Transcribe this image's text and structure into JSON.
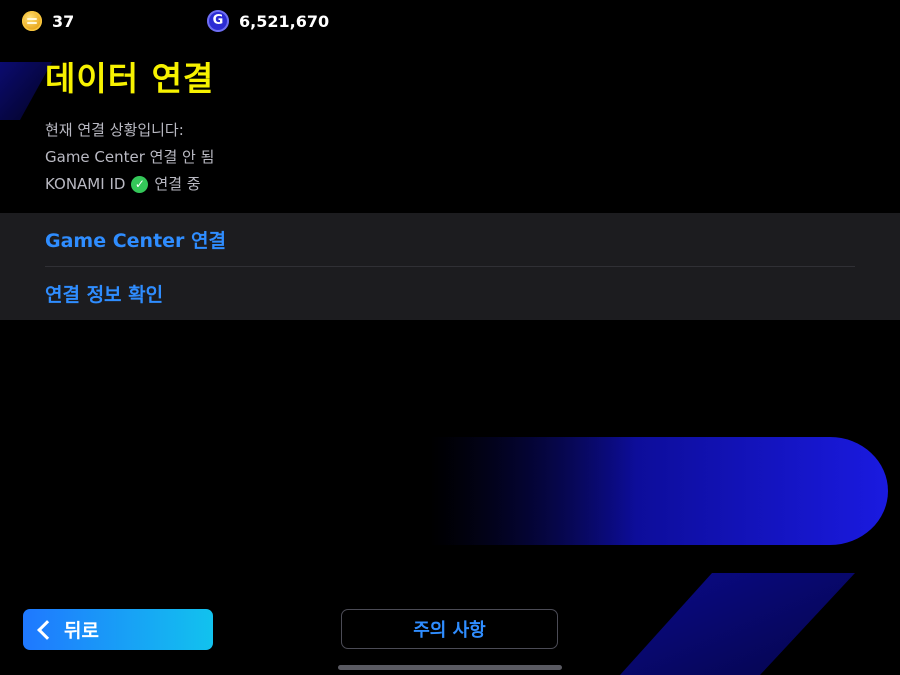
{
  "topbar": {
    "coins": {
      "icon": "coin-icon",
      "value": "37"
    },
    "gp": {
      "icon": "gp-icon",
      "symbol": "G",
      "value": "6,521,670"
    }
  },
  "page": {
    "title": "데이터 연결",
    "status_intro": "현재 연결 상황입니다:",
    "game_center_status": "Game Center 연결 안 됨",
    "konami_label": "KONAMI ID",
    "konami_status": "연결 중",
    "konami_icon": "check-icon"
  },
  "menu": {
    "items": [
      {
        "label": "Game Center 연결"
      },
      {
        "label": "연결 정보 확인"
      }
    ]
  },
  "footer": {
    "back_label": "뒤로",
    "notice_label": "주의 사항"
  },
  "colors": {
    "title": "#f7f200",
    "link": "#2f8dff",
    "accent_gradient_start": "#1f78ff",
    "accent_gradient_end": "#12c2ee",
    "deco_blue": "#1a1ad8"
  }
}
